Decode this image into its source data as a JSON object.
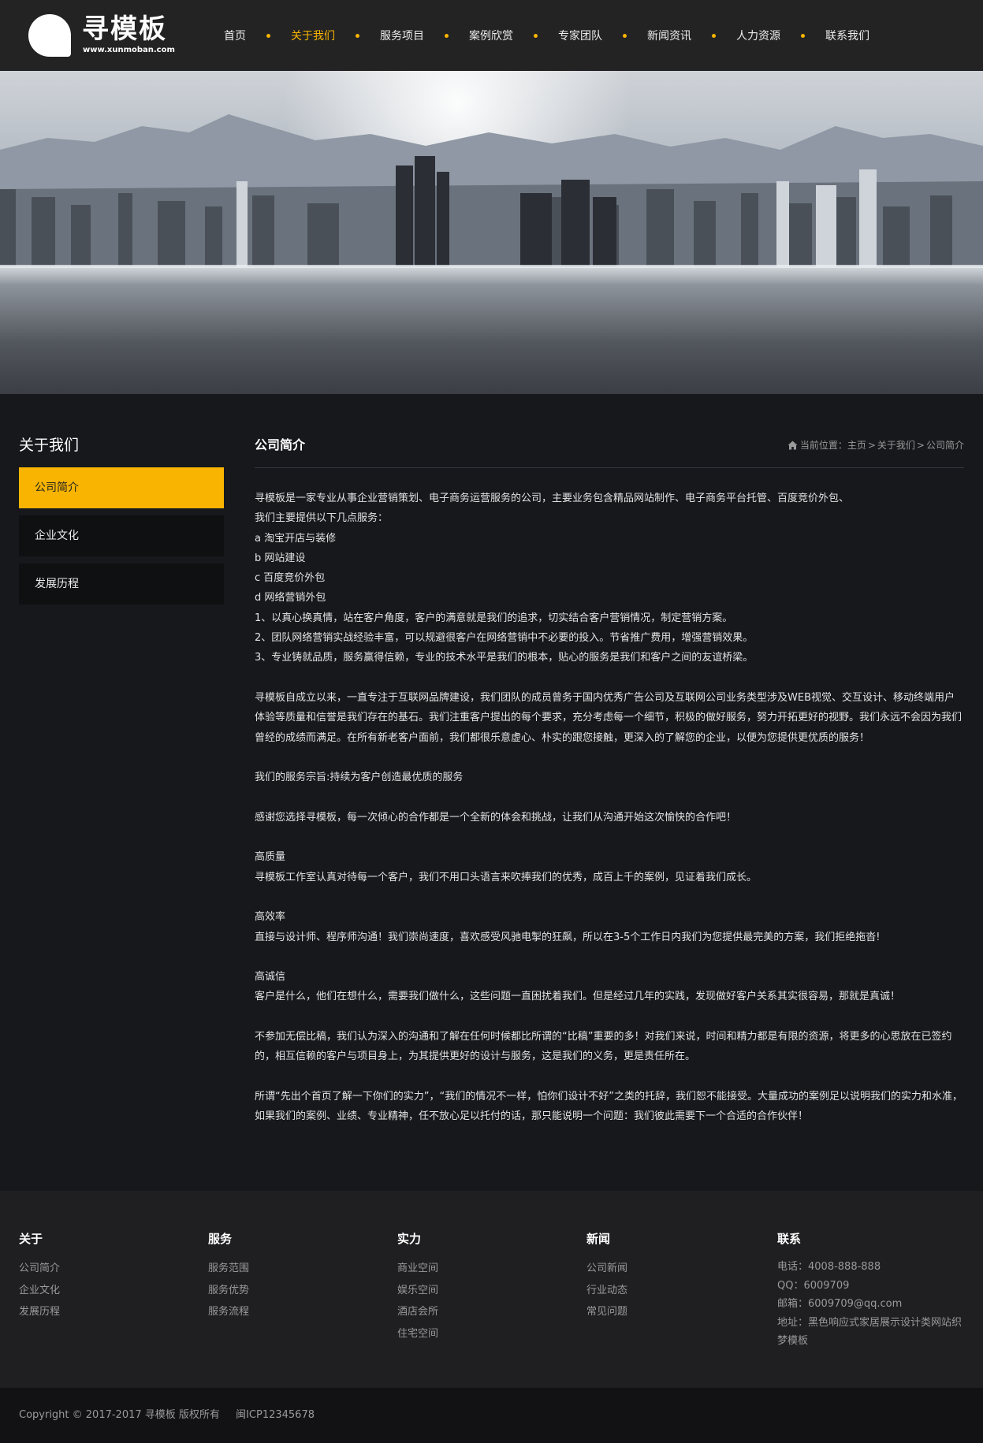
{
  "header": {
    "logo_text": "寻模板",
    "logo_sub": "www.xunmoban.com",
    "nav": [
      "首页",
      "关于我们",
      "服务项目",
      "案例欣赏",
      "专家团队",
      "新闻资讯",
      "人力资源",
      "联系我们"
    ],
    "active_index": 1,
    "accent": "#f8b400"
  },
  "sidebar": {
    "title": "关于我们",
    "items": [
      "公司简介",
      "企业文化",
      "发展历程"
    ],
    "active_index": 0
  },
  "content": {
    "title": "公司简介",
    "breadcrumb": {
      "label": "当前位置：",
      "items": [
        "主页",
        "关于我们",
        "公司简介"
      ]
    },
    "paragraphs": [
      "寻模板是一家专业从事企业营销策划、电子商务运营服务的公司，主要业务包含精品网站制作、电子商务平台托管、百度竞价外包、",
      "我们主要提供以下几点服务：",
      "a  淘宝开店与装修",
      "b  网站建设",
      "c  百度竞价外包",
      "d  网络营销外包",
      "1、以真心换真情，站在客户角度，客户的满意就是我们的追求，切实结合客户营销情况，制定营销方案。",
      "2、团队网络营销实战经验丰富，可以规避很客户在网络营销中不必要的投入。节省推广费用，增强营销效果。",
      "3、专业铸就品质，服务赢得信赖，专业的技术水平是我们的根本，贴心的服务是我们和客户之间的友谊桥梁。",
      "",
      "寻模板自成立以来，一直专注于互联网品牌建设，我们团队的成员曾务于国内优秀广告公司及互联网公司业务类型涉及WEB视觉、交互设计、移动终端用户体验等质量和信誉是我们存在的基石。我们注重客户提出的每个要求，充分考虑每一个细节，积极的做好服务，努力开拓更好的视野。我们永远不会因为我们曾经的成绩而满足。在所有新老客户面前，我们都很乐意虚心、朴实的跟您接触，更深入的了解您的企业，以便为您提供更优质的服务！",
      "",
      "我们的服务宗旨:持续为客户创造最优质的服务",
      "",
      "感谢您选择寻模板，每一次倾心的合作都是一个全新的体会和挑战，让我们从沟通开始这次愉快的合作吧！",
      "",
      "高质量",
      "寻模板工作室认真对待每一个客户，我们不用口头语言来吹捧我们的优秀，成百上千的案例，见证着我们成长。",
      "",
      "高效率",
      "直接与设计师、程序师沟通！我们崇尚速度，喜欢感受风驰电掣的狂飙，所以在3-5个工作日内我们为您提供最完美的方案，我们拒绝拖沓!",
      "",
      "高诚信",
      "客户是什么，他们在想什么，需要我们做什么，这些问题一直困扰着我们。但是经过几年的实践，发现做好客户关系其实很容易，那就是真诚！",
      "",
      "不参加无偿比稿，我们认为深入的沟通和了解在任何时候都比所谓的“比稿”重要的多！对我们来说，时间和精力都是有限的资源，将更多的心思放在已签约的，相互信赖的客户与项目身上，为其提供更好的设计与服务，这是我们的义务，更是责任所在。",
      "",
      "所谓“先出个首页了解一下你们的实力”，“我们的情况不一样，怕你们设计不好”之类的托辞，我们恕不能接受。大量成功的案例足以说明我们的实力和水准，如果我们的案例、业绩、专业精神，任不放心足以托付的话，那只能说明一个问题：我们彼此需要下一个合适的合作伙伴！"
    ]
  },
  "footer": {
    "columns": [
      {
        "title": "关于",
        "links": [
          "公司简介",
          "企业文化",
          "发展历程"
        ]
      },
      {
        "title": "服务",
        "links": [
          "服务范围",
          "服务优势",
          "服务流程"
        ]
      },
      {
        "title": "实力",
        "links": [
          "商业空间",
          "娱乐空间",
          "酒店会所",
          "住宅空间"
        ]
      },
      {
        "title": "新闻",
        "links": [
          "公司新闻",
          "行业动态",
          "常见问题"
        ]
      }
    ],
    "contact": {
      "title": "联系",
      "phone": "电话：4008-888-888",
      "qq": "QQ：6009709",
      "email": "邮箱：6009709@qq.com",
      "address": "地址：黑色响应式家居展示设计类网站织梦模板"
    },
    "copyright": "Copyright © 2017-2017 寻模板 版权所有",
    "icp": "闽ICP12345678"
  }
}
